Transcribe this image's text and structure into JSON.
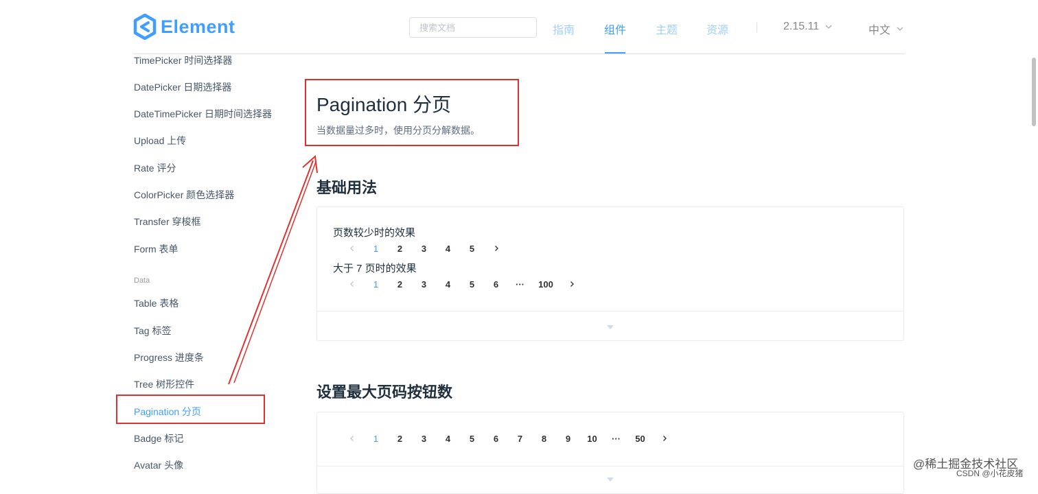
{
  "brand": {
    "name": "Element",
    "color": "#409eff"
  },
  "search": {
    "placeholder": "搜索文档"
  },
  "nav": {
    "items": [
      "指南",
      "组件",
      "主题",
      "资源"
    ],
    "active": "组件"
  },
  "version": {
    "label": "2.15.11"
  },
  "language": {
    "label": "中文"
  },
  "sidebar": {
    "items_top": [
      "TimePicker 时间选择器",
      "DatePicker 日期选择器",
      "DateTimePicker 日期时间选择器",
      "Upload 上传",
      "Rate 评分",
      "ColorPicker 颜色选择器",
      "Transfer 穿梭框",
      "Form 表单"
    ],
    "group_data": "Data",
    "items_data": [
      "Table 表格",
      "Tag 标签",
      "Progress 进度条",
      "Tree 树形控件",
      "Pagination 分页",
      "Badge 标记",
      "Avatar 头像"
    ],
    "active": "Pagination 分页"
  },
  "page": {
    "title": "Pagination 分页",
    "description": "当数据量过多时，使用分页分解数据。"
  },
  "sections": {
    "basic": {
      "title": "基础用法",
      "label_few": "页数较少时的效果",
      "pager_few": [
        "1",
        "2",
        "3",
        "4",
        "5"
      ],
      "label_many": "大于 7 页时的效果",
      "pager_many": [
        "1",
        "2",
        "3",
        "4",
        "5",
        "6",
        "···",
        "100"
      ]
    },
    "max_pager": {
      "title": "设置最大页码按钮数",
      "pager": [
        "1",
        "2",
        "3",
        "4",
        "5",
        "6",
        "7",
        "8",
        "9",
        "10",
        "···",
        "50"
      ]
    }
  },
  "watermark": {
    "line1": "@稀土掘金技术社区",
    "line2": "CSDN @小花皮猪"
  },
  "colors": {
    "accent": "#409eff",
    "annotation": "#e03131"
  }
}
